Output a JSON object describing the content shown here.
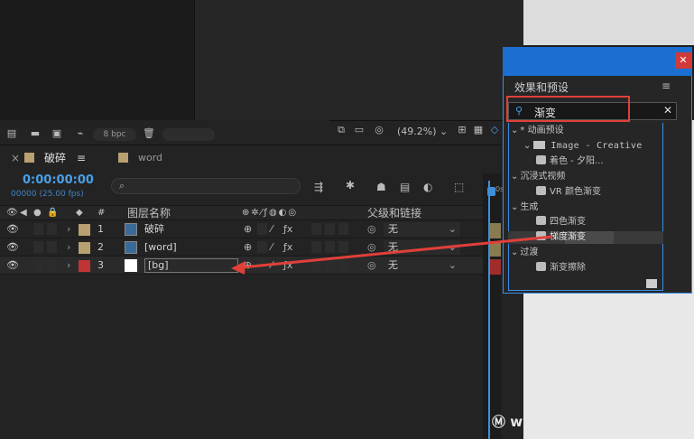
{
  "toolbar": {
    "bpc": "8 bpc"
  },
  "viewer": {
    "zoom": "(49.2%)",
    "zoom_chev": "⌄"
  },
  "timeline": {
    "tab_close": "×",
    "tab_active": "破碎",
    "tab_menu": "≡",
    "tab_other": "word",
    "timecode": "0:00:00:00",
    "timecode_sub": "00000 (25.00 fps)",
    "search_icon": "search-icon",
    "ruler_label": "0s",
    "columns": {
      "num": "#",
      "name": "图层名称",
      "parent": "父级和链接"
    },
    "layers": [
      {
        "num": "1",
        "name": "破碎",
        "parent": "无",
        "swatch": "#b8a070"
      },
      {
        "num": "2",
        "name": "[word]",
        "parent": "无",
        "swatch": "#b8a070"
      },
      {
        "num": "3",
        "name": "[bg]",
        "parent": "无",
        "swatch": "#c03434"
      }
    ]
  },
  "effects_panel": {
    "title": "效果和预设",
    "search_value": "渐变",
    "tree": [
      {
        "label": "* 动画预设",
        "indent": 0,
        "kind": "folder-open"
      },
      {
        "label": "Image - Creative",
        "indent": 1,
        "kind": "folder"
      },
      {
        "label": "着色 - 夕阳...",
        "indent": 2,
        "kind": "fx"
      },
      {
        "label": "沉浸式视频",
        "indent": 0,
        "kind": "folder-open"
      },
      {
        "label": "VR 颜色渐变",
        "indent": 2,
        "kind": "fx"
      },
      {
        "label": "生成",
        "indent": 0,
        "kind": "folder-open"
      },
      {
        "label": "四色渐变",
        "indent": 2,
        "kind": "fx"
      },
      {
        "label": "梯度渐变",
        "indent": 2,
        "kind": "fx",
        "selected": true
      },
      {
        "label": "过渡",
        "indent": 0,
        "kind": "folder-open"
      },
      {
        "label": "渐变擦除",
        "indent": 2,
        "kind": "fx"
      }
    ]
  },
  "watermark": "www.MacDown.com",
  "colors": {
    "accent": "#1a6fd1",
    "highlight": "#e0403a",
    "timecode": "#4aa0e8"
  }
}
